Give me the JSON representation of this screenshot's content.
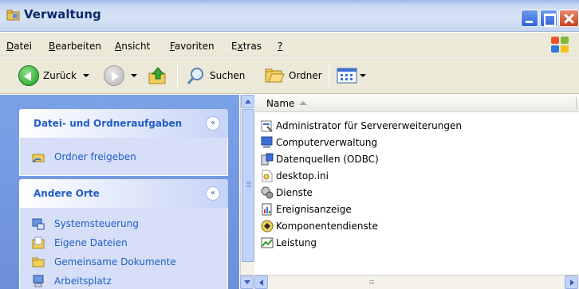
{
  "window": {
    "title": "Verwaltung",
    "buttons": {
      "minimize": "",
      "maximize": "",
      "close": ""
    }
  },
  "menu": {
    "items": [
      {
        "accel": "D",
        "rest": "atei"
      },
      {
        "accel": "B",
        "rest": "earbeiten"
      },
      {
        "accel": "A",
        "rest": "nsicht"
      },
      {
        "accel": "F",
        "rest": "avoriten"
      },
      {
        "pre": "E",
        "accel": "x",
        "rest": "tras"
      },
      {
        "accel": "?",
        "rest": ""
      }
    ]
  },
  "toolbar": {
    "back_label": "Zurück",
    "search_label": "Suchen",
    "folders_label": "Ordner"
  },
  "taskpane": {
    "file_tasks": {
      "header": "Datei- und Ordneraufgaben",
      "collapse_glyph": "«",
      "links": [
        "Ordner freigeben"
      ]
    },
    "other_places": {
      "header": "Andere Orte",
      "collapse_glyph": "«",
      "links": [
        "Systemsteuerung",
        "Eigene Dateien",
        "Gemeinsame Dokumente",
        "Arbeitsplatz"
      ]
    }
  },
  "filelist": {
    "column_name": "Name",
    "items": [
      {
        "name": "Administrator für Servererweiterungen",
        "icon": "admin-tool-icon"
      },
      {
        "name": "Computerverwaltung",
        "icon": "computer-management-icon"
      },
      {
        "name": "Datenquellen (ODBC)",
        "icon": "odbc-icon"
      },
      {
        "name": "desktop.ini",
        "icon": "ini-file-icon"
      },
      {
        "name": "Dienste",
        "icon": "services-icon"
      },
      {
        "name": "Ereignisanzeige",
        "icon": "event-viewer-icon"
      },
      {
        "name": "Komponentendienste",
        "icon": "component-services-icon"
      },
      {
        "name": "Leistung",
        "icon": "performance-icon"
      }
    ]
  },
  "colors": {
    "taskpane_bg": "#7ba2e7",
    "link_blue": "#215dc6",
    "titlebar_text": "#0b2a6b"
  }
}
